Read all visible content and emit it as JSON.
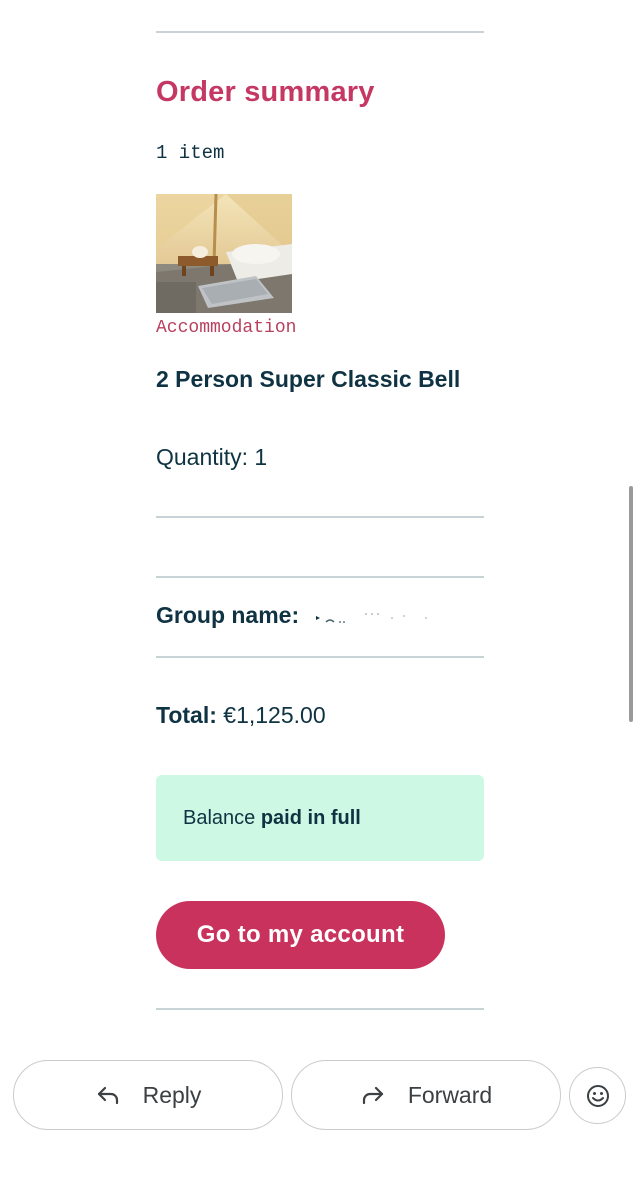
{
  "order_summary": {
    "title": "Order summary",
    "item_count": "1 item",
    "item": {
      "category": "Accommodation",
      "name": "2 Person Super Classic Bell",
      "quantity": "Quantity: 1",
      "image_icon": "bell-tent-photo"
    }
  },
  "group": {
    "label": "Group name:"
  },
  "total": {
    "label": "Total:",
    "value": "€1,125.00"
  },
  "balance": {
    "prefix": "Balance",
    "status": "paid in full"
  },
  "account_button": {
    "label": "Go to my account"
  },
  "bottom_actions": {
    "reply_label": "Reply",
    "reply_icon": "reply-icon",
    "forward_label": "Forward",
    "forward_icon": "forward-icon",
    "emoji_icon": "emoji-reaction-icon"
  },
  "colors": {
    "accent": "#c8325c",
    "heading": "#c53864",
    "text": "#0f3342",
    "success_bg": "#cdf8e4",
    "divider": "#c7d3d6"
  }
}
